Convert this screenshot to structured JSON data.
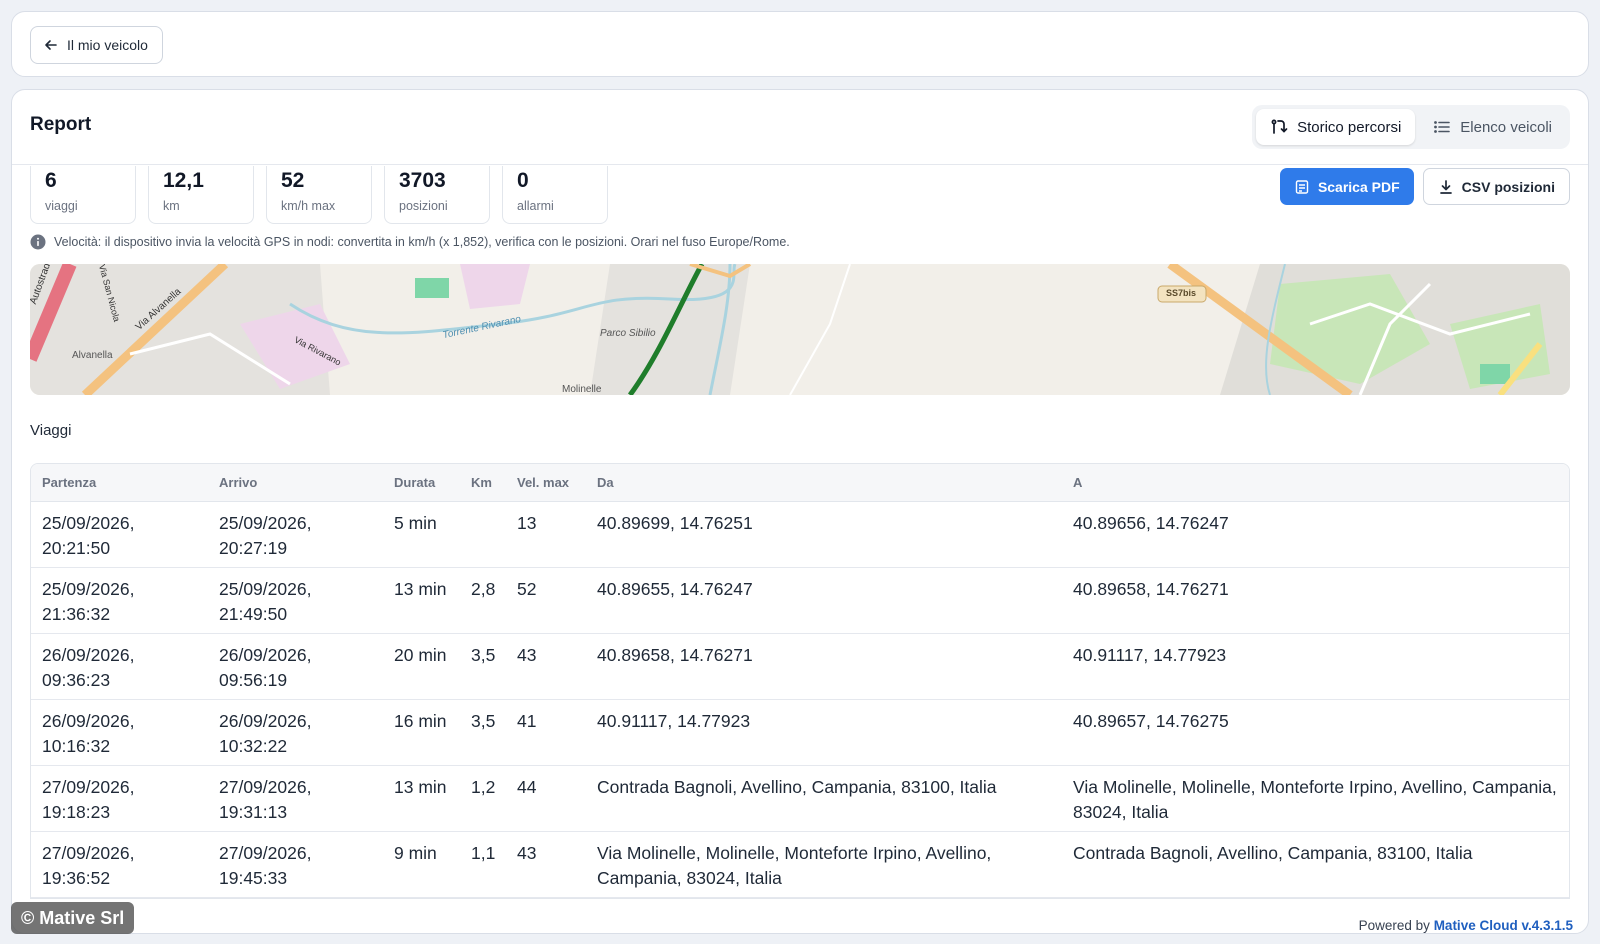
{
  "topbar": {
    "back_label": "Il mio veicolo"
  },
  "header": {
    "title": "Report",
    "tabs": [
      {
        "label": "Storico percorsi",
        "active": true,
        "icon": "route-icon"
      },
      {
        "label": "Elenco veicoli",
        "active": false,
        "icon": "list-icon"
      }
    ]
  },
  "stats": [
    {
      "value": "6",
      "label": "viaggi"
    },
    {
      "value": "12,1",
      "label": "km"
    },
    {
      "value": "52",
      "label": "km/h max"
    },
    {
      "value": "3703",
      "label": "posizioni"
    },
    {
      "value": "0",
      "label": "allarmi"
    }
  ],
  "actions": {
    "pdf_label": "Scarica PDF",
    "csv_label": "CSV posizioni"
  },
  "info_note": "Velocità: il dispositivo invia la velocità GPS in nodi: convertita in km/h (x 1,852), verifica con le posizioni. Orari nel fuso Europe/Rome.",
  "map": {
    "labels": [
      "Autostrada dei",
      "Via Alvanella",
      "Alvanella",
      "Torrente Rivarano",
      "Via Rivarano",
      "Parco Sibilio",
      "Molinelle",
      "SS7bis",
      "Via San Nicola"
    ]
  },
  "trips": {
    "title": "Viaggi",
    "columns": [
      "Partenza",
      "Arrivo",
      "Durata",
      "Km",
      "Vel. max",
      "Da",
      "A"
    ],
    "rows": [
      [
        "25/09/2026, 20:21:50",
        "25/09/2026, 20:27:19",
        "5 min",
        "",
        "13",
        "40.89699, 14.76251",
        "40.89656, 14.76247"
      ],
      [
        "25/09/2026, 21:36:32",
        "25/09/2026, 21:49:50",
        "13 min",
        "2,8",
        "52",
        "40.89655, 14.76247",
        "40.89658, 14.76271"
      ],
      [
        "26/09/2026, 09:36:23",
        "26/09/2026, 09:56:19",
        "20 min",
        "3,5",
        "43",
        "40.89658, 14.76271",
        "40.91117, 14.77923"
      ],
      [
        "26/09/2026, 10:16:32",
        "26/09/2026, 10:32:22",
        "16 min",
        "3,5",
        "41",
        "40.91117, 14.77923",
        "40.89657, 14.76275"
      ],
      [
        "27/09/2026, 19:18:23",
        "27/09/2026, 19:31:13",
        "13 min",
        "1,2",
        "44",
        "Contrada Bagnoli, Avellino, Campania, 83100, Italia",
        "Via Molinelle, Molinelle, Monteforte Irpino, Avellino, Campania, 83024, Italia"
      ],
      [
        "27/09/2026, 19:36:52",
        "27/09/2026, 19:45:33",
        "9 min",
        "1,1",
        "43",
        "Via Molinelle, Molinelle, Monteforte Irpino, Avellino, Campania, 83024, Italia",
        "Contrada Bagnoli, Avellino, Campania, 83100, Italia"
      ]
    ]
  },
  "footer": {
    "watermark": "© Mative Srl",
    "powered_prefix": "Powered by",
    "brand": "Mative Cloud v.4.3.1.5"
  }
}
